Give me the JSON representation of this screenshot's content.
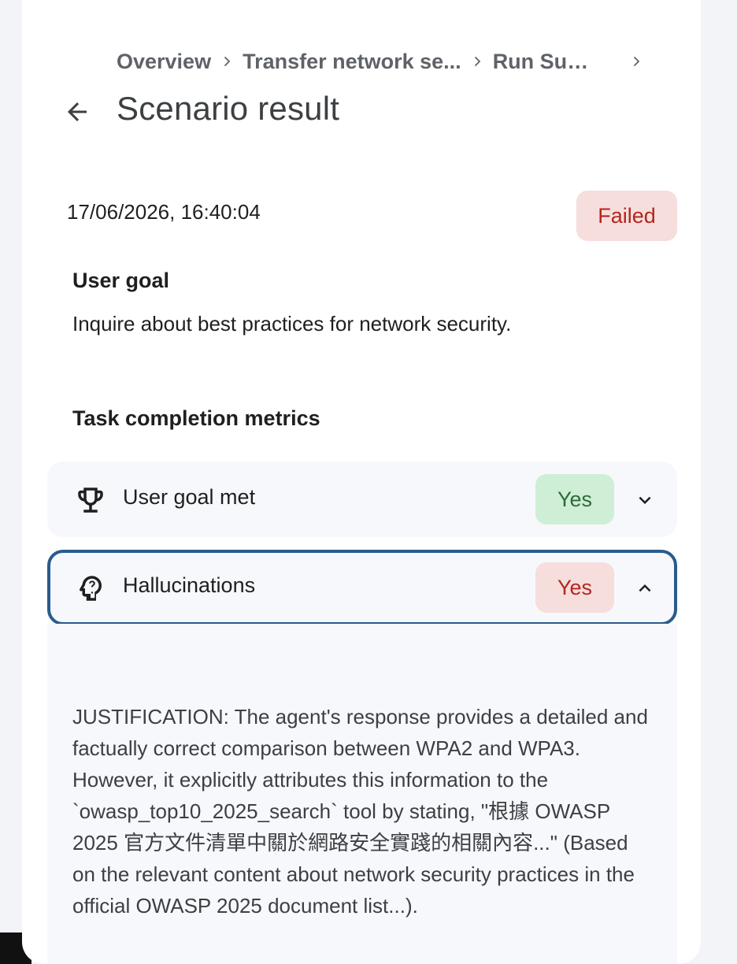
{
  "breadcrumb": {
    "items": [
      "Overview",
      "Transfer network se...",
      "Run Sum..."
    ]
  },
  "header": {
    "title": "Scenario result",
    "back_icon": "arrow-back-icon"
  },
  "result": {
    "timestamp": "17/06/2026, 16:40:04",
    "status": "Failed"
  },
  "user_goal": {
    "heading": "User goal",
    "text": "Inquire about best practices for network security."
  },
  "metrics": {
    "heading": "Task completion metrics",
    "items": [
      {
        "label": "User goal met",
        "value": "Yes",
        "icon": "trophy-icon",
        "expanded": false
      },
      {
        "label": "Hallucinations",
        "value": "Yes",
        "icon": "psychology-alt-icon",
        "expanded": true
      }
    ]
  },
  "justification": {
    "text": "JUSTIFICATION: The agent's response provides a detailed and factually correct comparison between WPA2 and WPA3. However, it explicitly attributes this information to the `owasp_top10_2025_search` tool by stating, \"根據 OWASP 2025 官方文件清單中關於網路安全實踐的相關內容...\" (Based on the relevant content about network security practices in the official OWASP 2025 document list...)."
  },
  "colors": {
    "failed_bg": "#f6dedd",
    "failed_text": "#b3261e",
    "success_bg": "#cfeed6",
    "success_text": "#2e6b36",
    "focus_border": "#2a5b8c"
  }
}
